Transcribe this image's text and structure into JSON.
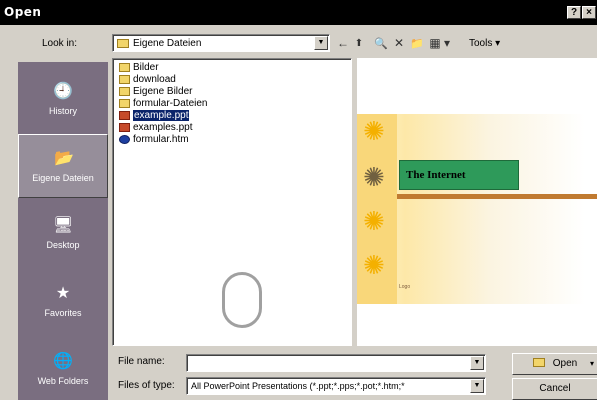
{
  "window": {
    "title": "Open",
    "help_label": "?",
    "close_label": "×"
  },
  "toolbar": {
    "look_in_label": "Look in:",
    "look_in_value": "Eigene Dateien",
    "back_icon": "←",
    "up_folder_icon": "⬆",
    "search_web_icon": "🔍",
    "delete_icon": "✕",
    "new_folder_icon": "📁",
    "views_icon": "▦",
    "views_arrow": "▾",
    "tools_label": "Tools ▾"
  },
  "places": [
    {
      "label": "History",
      "icon": "history-icon"
    },
    {
      "label": "Eigene Dateien",
      "icon": "my-documents-icon"
    },
    {
      "label": "Desktop",
      "icon": "desktop-icon"
    },
    {
      "label": "Favorites",
      "icon": "favorites-icon"
    },
    {
      "label": "Web Folders",
      "icon": "web-folders-icon"
    }
  ],
  "files": [
    {
      "name": "Bilder",
      "type": "folder"
    },
    {
      "name": "download",
      "type": "folder"
    },
    {
      "name": "Eigene Bilder",
      "type": "folder"
    },
    {
      "name": "formular-Dateien",
      "type": "folder"
    },
    {
      "name": "example.ppt",
      "type": "ppt",
      "selected": true
    },
    {
      "name": "examples.ppt",
      "type": "ppt"
    },
    {
      "name": "formular.htm",
      "type": "htm"
    }
  ],
  "preview": {
    "slide_title": "The Internet",
    "footer_text": "Logo"
  },
  "bottom": {
    "file_name_label": "File name:",
    "file_name_value": "",
    "files_of_type_label": "Files of type:",
    "files_of_type_value": "All PowerPoint Presentations (*.ppt;*.pps;*.pot;*.htm;*",
    "open_label": "Open",
    "cancel_label": "Cancel"
  },
  "colors": {
    "title_bar": "#000000",
    "places_bar": "#7a6e80",
    "selection": "#0a246a",
    "slide_title_bg": "#2e9a5a"
  }
}
